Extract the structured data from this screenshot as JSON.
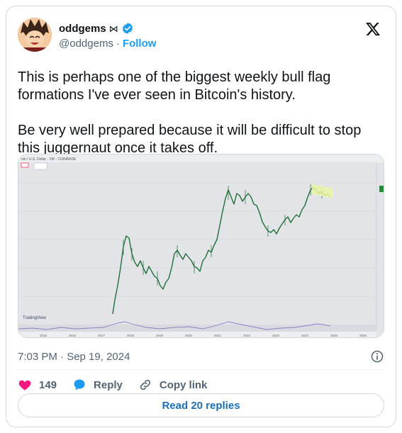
{
  "author": {
    "display_name": "oddgems",
    "bowtie": "⋈",
    "handle": "@oddgems",
    "separator": "·",
    "follow_label": "Follow"
  },
  "tweet": {
    "text": "This is perhaps one of the biggest weekly bull flag formations I've ever seen in Bitcoin's history.\n\nBe very well prepared because it will be difficult to stop this juggernaut once it takes off."
  },
  "chart_header": {
    "symbol": "oin / U.S. Dollar · 1W · COINBASE",
    "watermark": "TradingView",
    "x_ticks": [
      "2015",
      "2016",
      "2017",
      "2018",
      "2019",
      "2020",
      "2021",
      "2022",
      "2023",
      "2024",
      "2025",
      "2026"
    ]
  },
  "meta": {
    "timestamp": "7:03 PM · Sep 19, 2024"
  },
  "actions": {
    "like_count": "149",
    "reply_label": "Reply",
    "copy_link_label": "Copy link"
  },
  "read_replies_label": "Read 20 replies",
  "colors": {
    "like": "#f91880",
    "reply": "#1d9bf0",
    "verified": "#1d9bf0",
    "candle": "#1f6f3a",
    "rsi": "#8e7cc3",
    "flag_highlight": "#e9f5a3"
  }
}
